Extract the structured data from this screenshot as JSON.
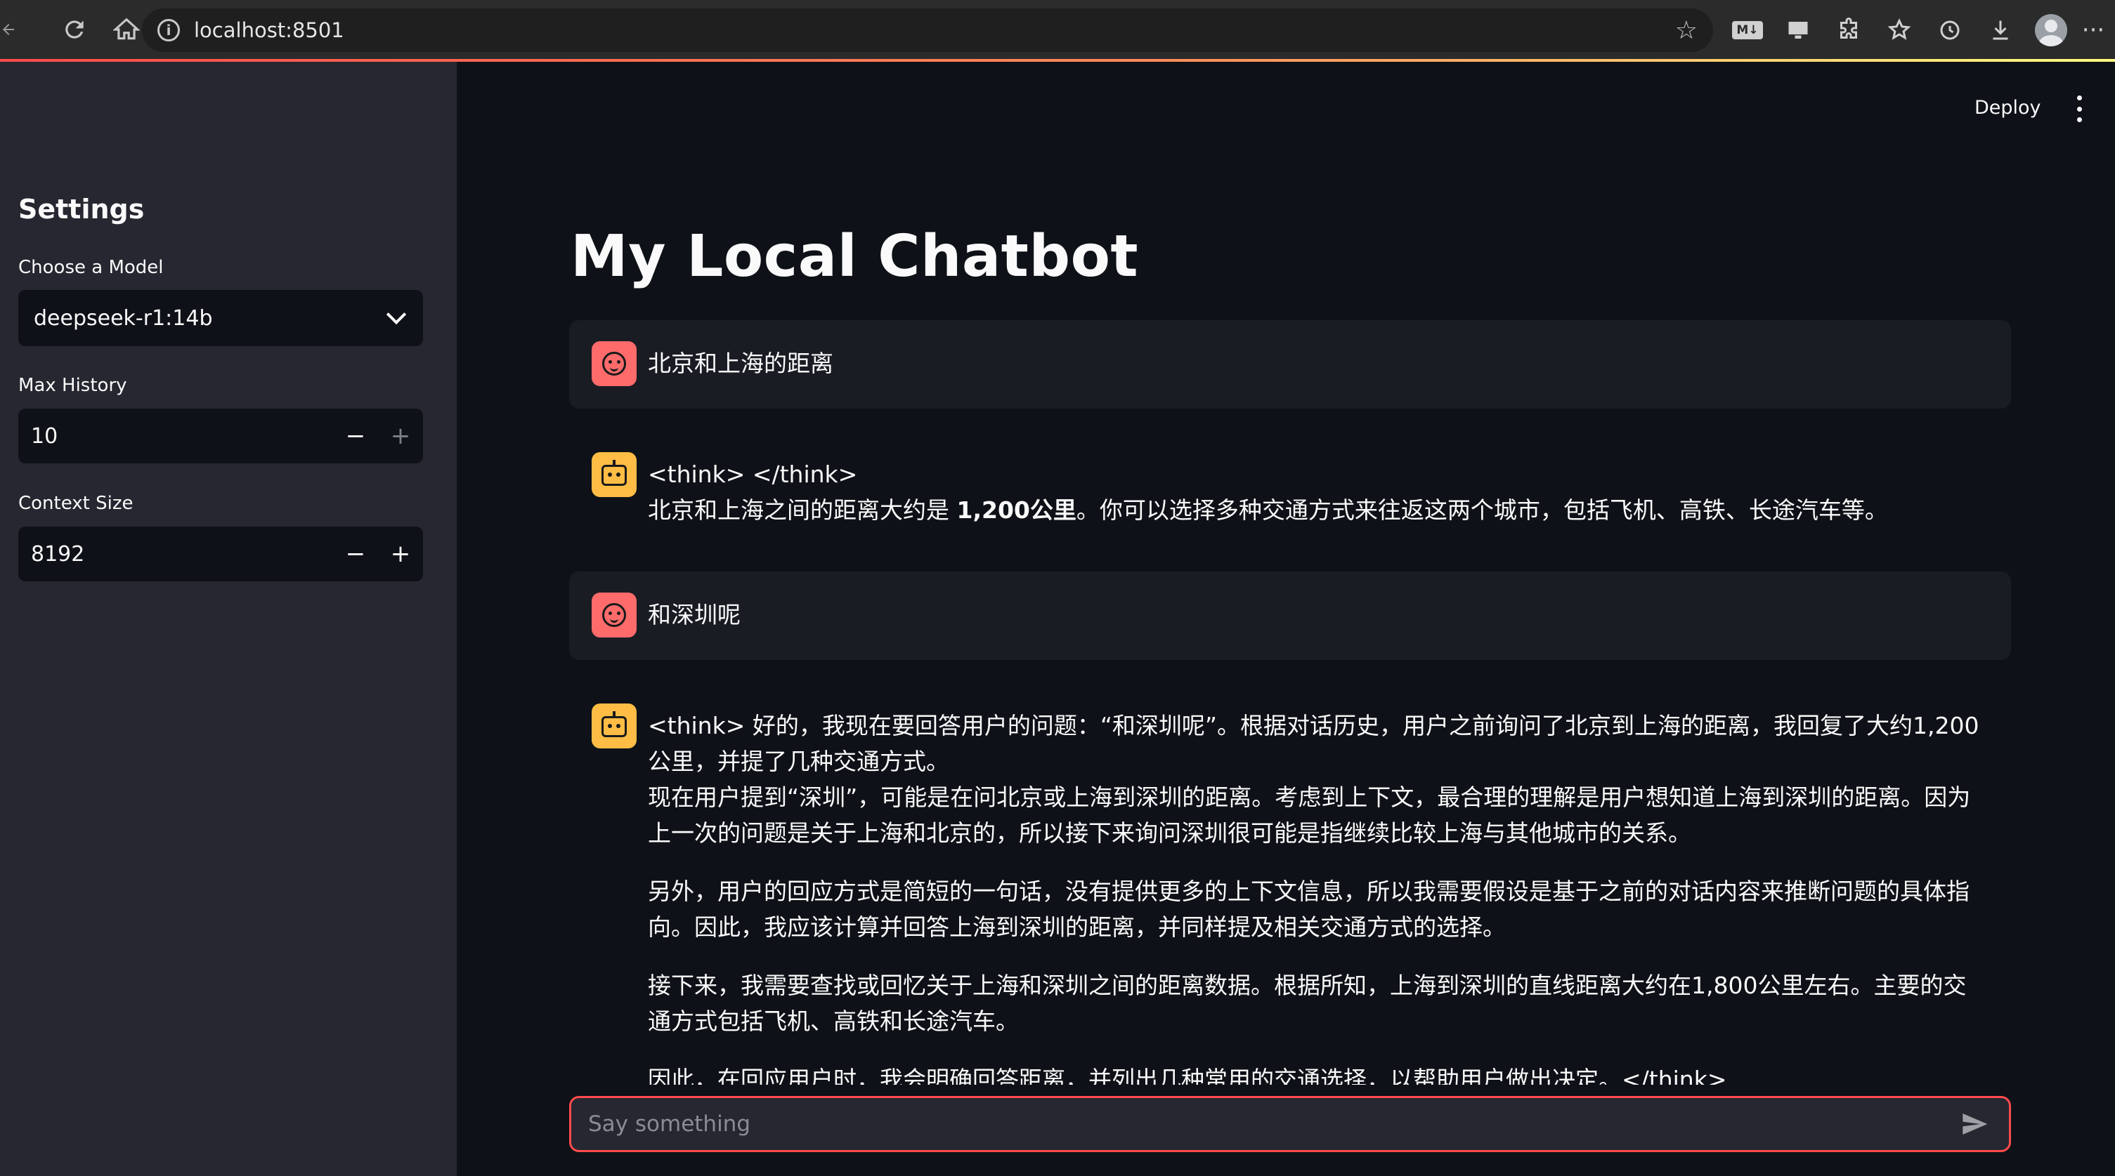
{
  "browser": {
    "url": "localhost:8501",
    "ext_md_label": "M↓"
  },
  "sidebar": {
    "title": "Settings",
    "model_label": "Choose a Model",
    "model_value": "deepseek-r1:14b",
    "history_label": "Max History",
    "history_value": "10",
    "context_label": "Context Size",
    "context_value": "8192"
  },
  "header": {
    "deploy_label": "Deploy"
  },
  "main": {
    "title": "My Local Chatbot",
    "messages": [
      {
        "role": "user",
        "text": "北京和上海的距离"
      },
      {
        "role": "assistant",
        "think": "<think> </think>",
        "answer_pre": "北京和上海之间的距离大约是 ",
        "answer_bold": "1,200公里",
        "answer_post": "。你可以选择多种交通方式来往返这两个城市，包括飞机、高铁、长途汽车等。"
      },
      {
        "role": "user",
        "text": "和深圳呢"
      },
      {
        "role": "assistant",
        "p1a": "<think> 好的，我现在要回答用户的问题：“和深圳呢”。根据对话历史，用户之前询问了北京到上海的距离，我回复了大约1,200公里，并提了几种交通方式。",
        "p1b": "现在用户提到“深圳”，可能是在问北京或上海到深圳的距离。考虑到上下文，最合理的理解是用户想知道上海到深圳的距离。因为上一次的问题是关于上海和北京的，所以接下来询问深圳很可能是指继续比较上海与其他城市的关系。",
        "p2": "另外，用户的回应方式是简短的一句话，没有提供更多的上下文信息，所以我需要假设是基于之前的对话内容来推断问题的具体指向。因此，我应该计算并回答上海到深圳的距离，并同样提及相关交通方式的选择。",
        "p3": "接下来，我需要查找或回忆关于上海和深圳之间的距离数据。根据所知，上海到深圳的直线距离大约在1,800公里左右。主要的交通方式包括飞机、高铁和长途汽车。",
        "p4": "因此，在回应用户时，我会明确回答距离，并列出几种常用的交通选择，以帮助用户做出决定。</think>"
      }
    ]
  },
  "chat_input": {
    "placeholder": "Say something"
  }
}
